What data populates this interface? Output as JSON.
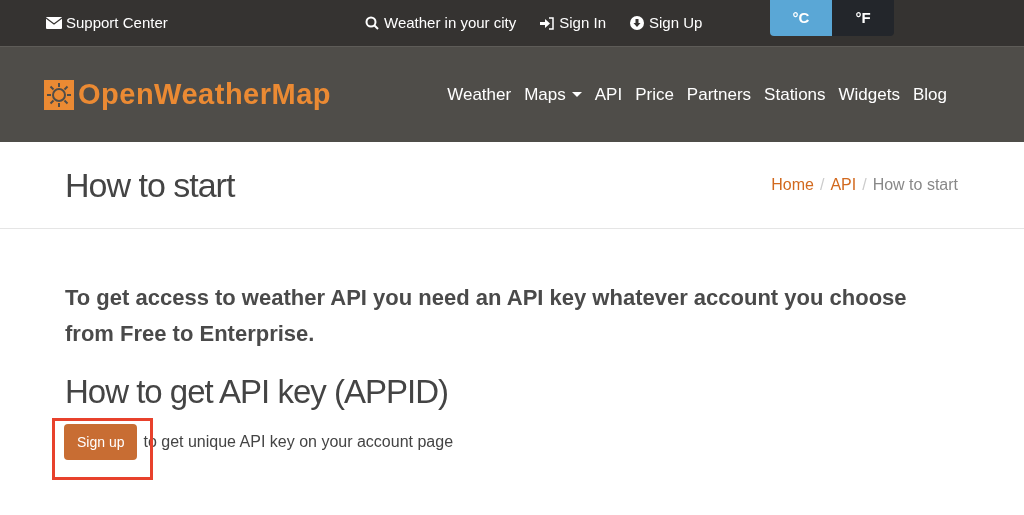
{
  "top_bar": {
    "support": "Support Center",
    "links": [
      {
        "kind": "search",
        "label": "Weather in your city"
      },
      {
        "kind": "signin",
        "label": "Sign In"
      },
      {
        "kind": "signup",
        "label": "Sign Up"
      }
    ],
    "units": [
      {
        "label": "°C",
        "selected": true
      },
      {
        "label": "°F",
        "selected": false
      }
    ]
  },
  "nav": {
    "logo": "OpenWeatherMap",
    "items": [
      {
        "label": "Weather",
        "dropdown": false
      },
      {
        "label": "Maps",
        "dropdown": true
      },
      {
        "label": "API",
        "dropdown": false
      },
      {
        "label": "Price",
        "dropdown": false
      },
      {
        "label": "Partners",
        "dropdown": false
      },
      {
        "label": "Stations",
        "dropdown": false
      },
      {
        "label": "Widgets",
        "dropdown": false
      },
      {
        "label": "Blog",
        "dropdown": false
      }
    ]
  },
  "header": {
    "title": "How to start",
    "separator": "/",
    "breadcrumbs": [
      {
        "label": "Home",
        "link": true
      },
      {
        "label": "API",
        "link": true
      },
      {
        "label": "How to start",
        "link": false
      }
    ]
  },
  "content": {
    "intro": "To get access to weather API you need an API key whatever account you choose from Free to Enterprise.",
    "heading": "How to get API key (APPID)",
    "button": "Sign up",
    "button_text": "to get unique API key on your account page",
    "highlighted": true
  }
}
